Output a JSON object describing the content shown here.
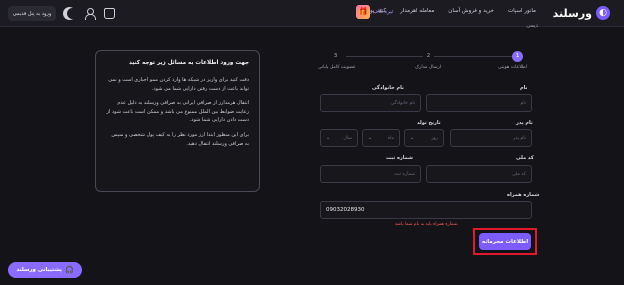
{
  "header": {
    "logo_text": "ورسلند",
    "nav_items": [
      "مانور اسپات",
      "خرید و فروش آسان",
      "معامله اهرمدار",
      "کیف پول"
    ],
    "promo_label": "تیره کاب",
    "legacy_button": "ورود به پنل قدیمی"
  },
  "page": {
    "title": "دیمی"
  },
  "steps": [
    {
      "number": "1",
      "label": "اطلاعات هویتی"
    },
    {
      "number": "2",
      "label": "ارسال مدارک"
    },
    {
      "number": "3",
      "label": "عضویت کامل پایانی"
    }
  ],
  "form": {
    "first_name": {
      "label": "نام",
      "placeholder": "نام"
    },
    "last_name": {
      "label": "نام خانوادگی",
      "placeholder": "نام خانوادگی"
    },
    "father_name": {
      "label": "نام پدر",
      "placeholder": "نام پدر"
    },
    "birth_date": {
      "label": "تاریخ تولد",
      "day": "روز",
      "month": "ماه",
      "year": "سال"
    },
    "national_code": {
      "label": "کد ملی",
      "placeholder": "کد ملی"
    },
    "id_number": {
      "label": "شماره ثبت",
      "placeholder": "شماره ثبت"
    },
    "phone": {
      "label": "شماره همراه",
      "value": "09032028930"
    },
    "error_text": "شماره همراه باید به نام شما باشد.",
    "submit_label": "اطلاعات محرمانه"
  },
  "info_box": {
    "title": "جهت ورود اطلاعات به مسائل زیر توجه کنید",
    "paragraphs": [
      "دقت کنید برای واریز در شبکه ها وارد کردن ممو اجباری است و نمی تواند باعث از دست رفتن دارایی شما می شود.",
      "انتقال هرمدارز از صرافی ایرانی به صرافی ورسلند به دلیل عدم رعایت ضوابط بین الملل ممنوع می باشد و ممکن است باعث شود از دست دادن دارایی شما شود.",
      "برای این منظور ابتدا ارز مورد نظر را به کیف پول شخصی و سپس به صرافی ورسلند انتقال دهید."
    ]
  },
  "support": {
    "label": "پشتیبانی ورسلند"
  }
}
